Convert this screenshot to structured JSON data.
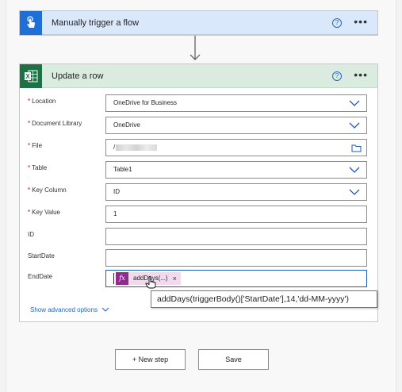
{
  "trigger": {
    "title": "Manually trigger a flow",
    "help_icon": "?",
    "more_icon": "•••",
    "icon": "touch-hand-icon",
    "color": "#1f6fd8"
  },
  "update": {
    "title": "Update a row",
    "help_icon": "?",
    "more_icon": "•••",
    "icon": "excel-icon",
    "color": "#1e7145"
  },
  "fields": {
    "location": {
      "label": "Location",
      "required_mark": "*",
      "value": "OneDrive for Business"
    },
    "document_library": {
      "label": "Document Library",
      "required_mark": "*",
      "value": "OneDrive"
    },
    "file": {
      "label": "File",
      "required_mark": "*",
      "value": "/"
    },
    "table": {
      "label": "Table",
      "required_mark": "*",
      "value": "Table1"
    },
    "key_column": {
      "label": "Key Column",
      "required_mark": "*",
      "value": "ID"
    },
    "key_value": {
      "label": "Key Value",
      "required_mark": "*",
      "value": "1"
    },
    "id": {
      "label": "ID",
      "value": ""
    },
    "startdate": {
      "label": "StartDate",
      "value": ""
    },
    "enddate": {
      "label": "EndDate",
      "token_icon": "fx",
      "token_text": "addDays(...)",
      "token_close": "×"
    }
  },
  "advanced_link": "Show advanced options",
  "tooltip": "addDays(triggerBody()['StartDate'],14,'dd-MM-yyyy')",
  "footer": {
    "new_step": "+ New step",
    "save": "Save"
  }
}
